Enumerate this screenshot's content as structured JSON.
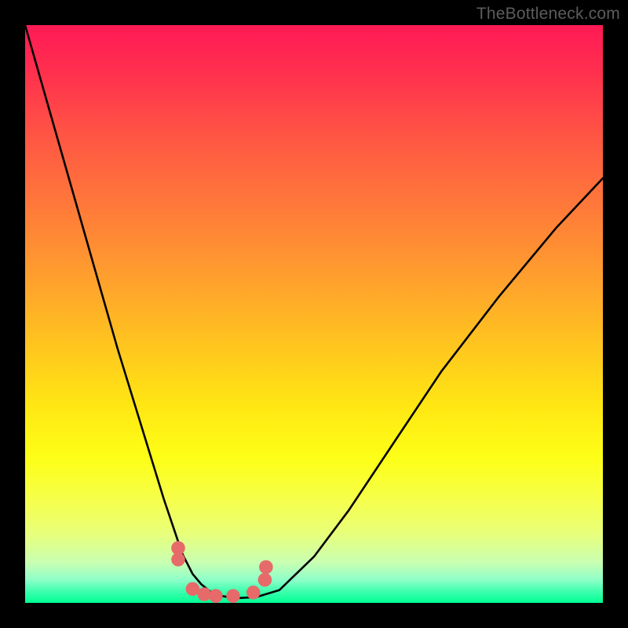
{
  "watermark": {
    "text": "TheBottleneck.com"
  },
  "chart_data": {
    "type": "line",
    "title": "",
    "xlabel": "",
    "ylabel": "",
    "xlim": [
      0,
      1
    ],
    "ylim": [
      0,
      1
    ],
    "series": [
      {
        "name": "black-curve",
        "x": [
          0.0,
          0.04,
          0.08,
          0.12,
          0.16,
          0.2,
          0.24,
          0.272,
          0.29,
          0.305,
          0.32,
          0.34,
          0.365,
          0.4,
          0.44,
          0.5,
          0.56,
          0.64,
          0.72,
          0.82,
          0.92,
          1.0
        ],
        "y": [
          1.0,
          0.86,
          0.72,
          0.58,
          0.44,
          0.31,
          0.18,
          0.085,
          0.05,
          0.032,
          0.02,
          0.012,
          0.008,
          0.01,
          0.022,
          0.08,
          0.16,
          0.28,
          0.4,
          0.53,
          0.65,
          0.735
        ]
      },
      {
        "name": "pink-dots",
        "x": [
          0.265,
          0.265,
          0.29,
          0.31,
          0.33,
          0.36,
          0.395,
          0.415,
          0.417
        ],
        "y": [
          0.095,
          0.075,
          0.024,
          0.015,
          0.012,
          0.012,
          0.018,
          0.04,
          0.062
        ]
      }
    ],
    "background_gradient": {
      "direction": "vertical",
      "stops": [
        {
          "pos": 0.0,
          "color": "#ff1a55"
        },
        {
          "pos": 0.5,
          "color": "#ffc41f"
        },
        {
          "pos": 0.8,
          "color": "#fdff17"
        },
        {
          "pos": 1.0,
          "color": "#00ff93"
        }
      ]
    },
    "styles": {
      "black-curve": {
        "stroke": "#000000",
        "stroke_width": 2.6,
        "fill": "none"
      },
      "pink-dots": {
        "fill": "#e66a6a",
        "radius_frac": 0.012
      }
    }
  }
}
